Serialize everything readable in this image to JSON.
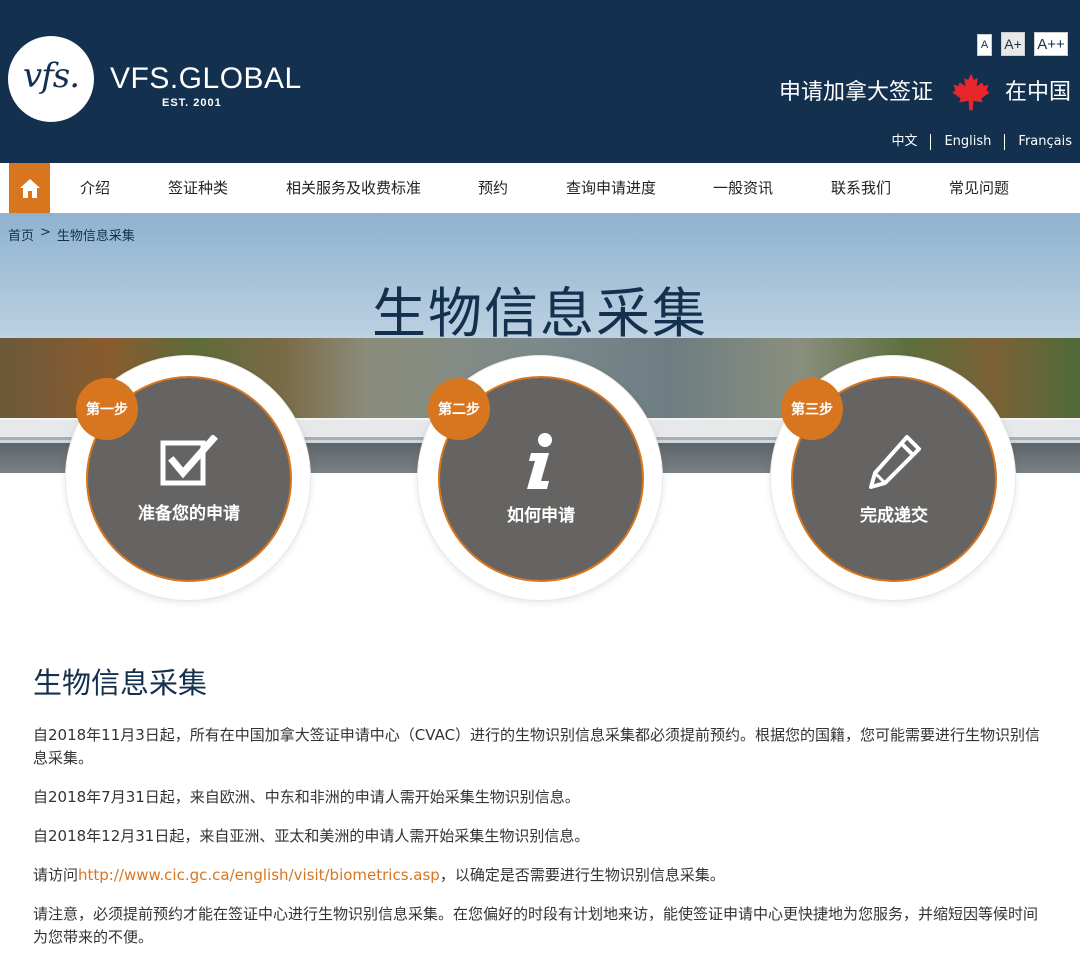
{
  "header": {
    "logo_text": "vfs.",
    "brand": "VFS.GLOBAL",
    "brand_est": "EST. 2001",
    "font_size_buttons": [
      "A",
      "A+",
      "A++"
    ],
    "apply_text": "申请加拿大签证",
    "location_text": "在中国",
    "languages": [
      "中文",
      "English",
      "Français"
    ]
  },
  "nav": {
    "items": [
      "介绍",
      "签证种类",
      "相关服务及收费标准",
      "预约",
      "查询申请进度",
      "一般资讯",
      "联系我们",
      "常见问题"
    ]
  },
  "breadcrumb": {
    "home": "首页",
    "separator": ">",
    "current": "生物信息采集"
  },
  "hero": {
    "title": "生物信息采集"
  },
  "steps": [
    {
      "badge": "第一步",
      "label": "准备您的申请",
      "icon": "checkbox-icon"
    },
    {
      "badge": "第二步",
      "label": "如何申请",
      "icon": "info-icon"
    },
    {
      "badge": "第三步",
      "label": "完成递交",
      "icon": "pencil-icon"
    }
  ],
  "content": {
    "heading": "生物信息采集",
    "p1": "自2018年11月3日起，所有在中国加拿大签证申请中心（CVAC）进行的生物识别信息采集都必须提前预约。根据您的国籍，您可能需要进行生物识别信息采集。",
    "p2": "自2018年7月31日起，来自欧洲、中东和非洲的申请人需开始采集生物识别信息。",
    "p3": "自2018年12月31日起，来自亚洲、亚太和美洲的申请人需开始采集生物识别信息。",
    "p4_prefix": "请访问",
    "p4_link": "http://www.cic.gc.ca/english/visit/biometrics.asp",
    "p4_suffix": "，以确定是否需要进行生物识别信息采集。",
    "p5": "请注意，必须提前预约才能在签证中心进行生物识别信息采集。在您偏好的时段有计划地来访，能使签证申请中心更快捷地为您服务，并缩短因等候时间为您带来的不便。"
  },
  "colors": {
    "header_bg": "#14304f",
    "accent": "#d8761f",
    "step_circle": "#666462"
  }
}
